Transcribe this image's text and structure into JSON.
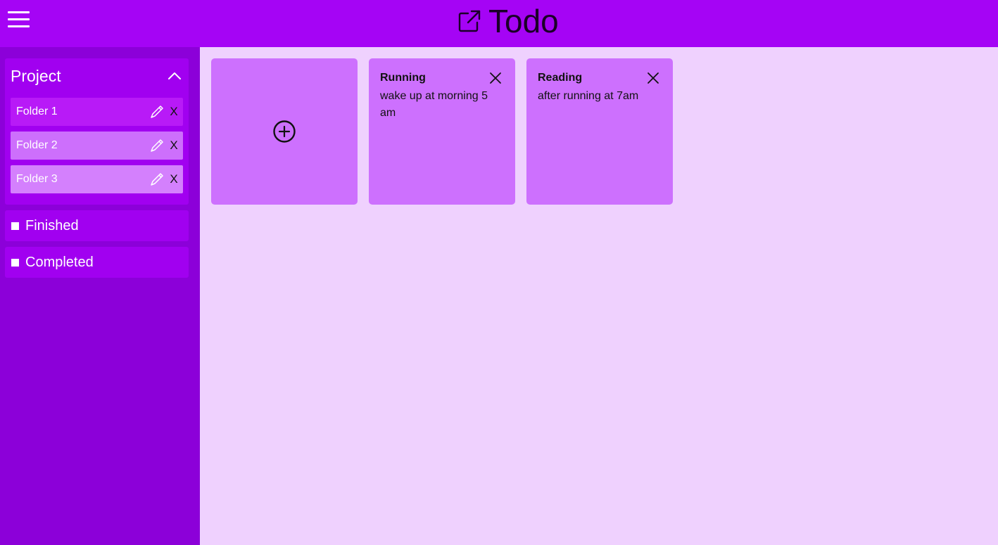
{
  "header": {
    "title": "Todo",
    "brand_icon": "edit-square-icon",
    "menu_icon": "hamburger-menu-icon",
    "background": "#a504f5"
  },
  "sidebar": {
    "background": "#8c00d9",
    "project": {
      "title": "Project",
      "toggle_icon": "chevron-up-icon",
      "folders": [
        {
          "label": "Folder 1",
          "edit_icon": "pencil-icon",
          "delete_label": "X",
          "color": "#b81af7"
        },
        {
          "label": "Folder 2",
          "edit_icon": "pencil-icon",
          "delete_label": "X",
          "color": "#cd6ffc"
        },
        {
          "label": "Folder 3",
          "edit_icon": "pencil-icon",
          "delete_label": "X",
          "color": "#d480fd"
        }
      ]
    },
    "filters": [
      {
        "label": "Finished"
      },
      {
        "label": "Completed"
      }
    ]
  },
  "main": {
    "background": "#efd1fe",
    "add_card": {
      "icon": "add-circle-icon"
    },
    "notes": [
      {
        "title": "Running",
        "body": "wake up at morning 5 am",
        "close_icon": "close-icon"
      },
      {
        "title": "Reading",
        "body": "after running at 7am",
        "close_icon": "close-icon"
      }
    ],
    "card_color": "#cd70fe"
  }
}
